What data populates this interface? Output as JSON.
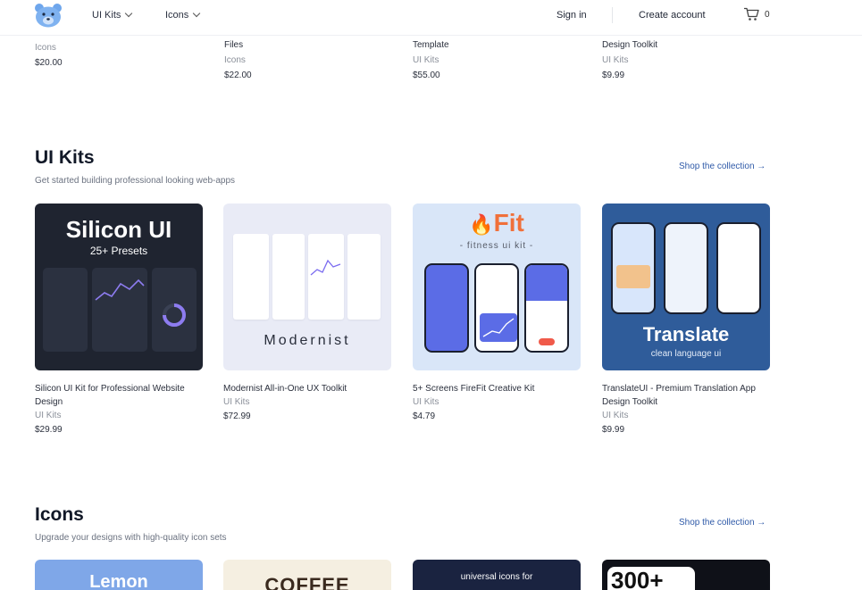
{
  "header": {
    "nav": [
      {
        "label": "UI Kits"
      },
      {
        "label": "Icons"
      }
    ],
    "sign_in": "Sign in",
    "create_account": "Create account",
    "cart_count": "0"
  },
  "top_row": [
    {
      "title": "",
      "category": "Icons",
      "price": "$20.00"
    },
    {
      "title": "Files",
      "category": "Icons",
      "price": "$22.00"
    },
    {
      "title": "Template",
      "category": "UI Kits",
      "price": "$55.00"
    },
    {
      "title": "Design Toolkit",
      "category": "UI Kits",
      "price": "$9.99"
    }
  ],
  "ui_kits": {
    "title": "UI Kits",
    "subtitle": "Get started building professional looking web-apps",
    "shop_link": "Shop the collection →",
    "cards": [
      {
        "name": "Silicon UI Kit for Professional Website Design",
        "category": "UI Kits",
        "price": "$29.99",
        "thumb_title": "Silicon UI",
        "thumb_sub": "25+ Presets"
      },
      {
        "name": "Modernist All-in-One UX Toolkit",
        "category": "UI Kits",
        "price": "$72.99",
        "thumb_title": "Modernist"
      },
      {
        "name": "5+ Screens FireFit Creative Kit",
        "category": "UI Kits",
        "price": "$4.79",
        "thumb_title": "Fit",
        "thumb_sub": "- fitness ui kit -"
      },
      {
        "name": "TranslateUI - Premium Translation App Design Toolkit",
        "category": "UI Kits",
        "price": "$9.99",
        "thumb_title": "Translate",
        "thumb_sub": "clean language ui"
      }
    ]
  },
  "icons": {
    "title": "Icons",
    "subtitle": "Upgrade your designs with high-quality icon sets",
    "shop_link": "Shop the collection →",
    "cards": [
      {
        "thumb_title": "Lemon"
      },
      {
        "thumb_title": "COFFEE"
      },
      {
        "thumb_title": "universal icons for"
      },
      {
        "thumb_title": "300+"
      }
    ]
  },
  "colors": {
    "accent": "#2f5aa8",
    "fit_orange": "#f0703a",
    "translate_blue": "#2f5c9a"
  }
}
